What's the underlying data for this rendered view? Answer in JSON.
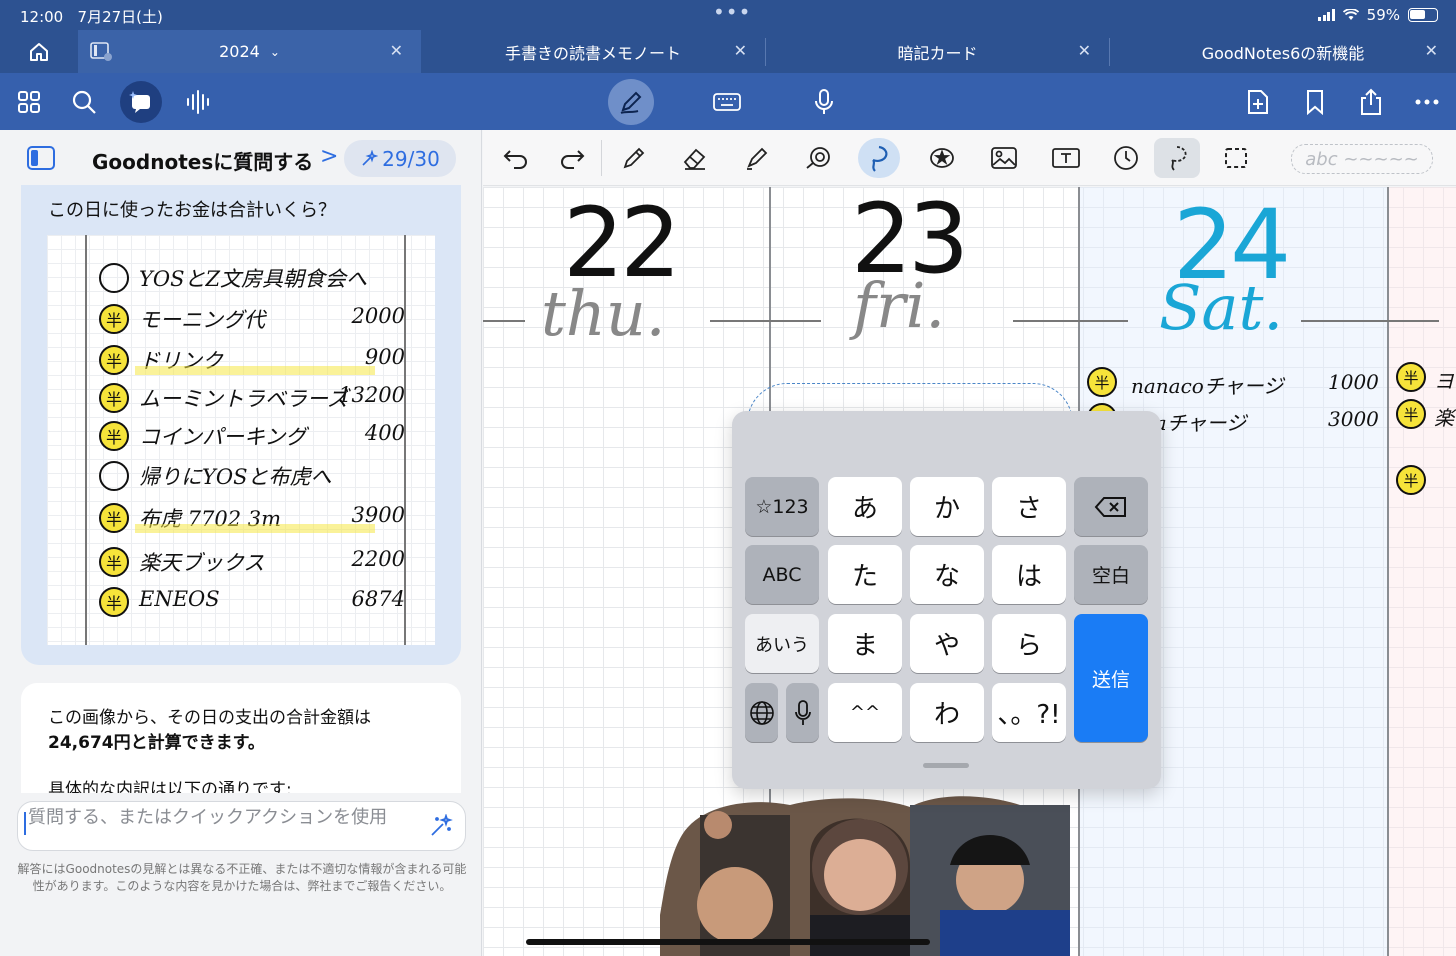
{
  "status": {
    "time": "12:00",
    "date": "7月27日(土)",
    "battery": "59%"
  },
  "tabs": [
    {
      "label": "2024",
      "active": true
    },
    {
      "label": "手書きの読書メモノート"
    },
    {
      "label": "暗記カード"
    },
    {
      "label": "GoodNotes6の新機能"
    }
  ],
  "panel": {
    "title": "Goodnotesに質問する",
    "quota": "29/30",
    "question": "この日に使ったお金は合計いくら？",
    "note_rows": [
      {
        "mark": "",
        "label": "YOSとZ文房具朝食会へ",
        "amount": ""
      },
      {
        "mark": "半",
        "label": "モーニング代",
        "amount": "2000"
      },
      {
        "mark": "半",
        "label": "ドリンク",
        "amount": "900"
      },
      {
        "mark": "半",
        "label": "ムーミントラベラーズ",
        "amount": "13200"
      },
      {
        "mark": "半",
        "label": "コインパーキング",
        "amount": "400"
      },
      {
        "mark": "",
        "label": "帰りにYOSと布虎へ",
        "amount": ""
      },
      {
        "mark": "半",
        "label": "布虎 7702 3m",
        "amount": "3900"
      },
      {
        "mark": "半",
        "label": "楽天ブックス",
        "amount": "2200"
      },
      {
        "mark": "半",
        "label": "ENEOS",
        "amount": "6874"
      }
    ],
    "answer_line1": "この画像から、その日の支出の合計金額は",
    "answer_line2": "24,674円と計算できます。",
    "answer_line3": "具体的な内訳は以下の通りです:",
    "input_placeholder": "質問する、またはクイックアクションを使用",
    "disclaimer": "解答にはGoodnotesの見解とは異なる不正確、または不適切な情報が含まれる可能性があります。このような内容を見かけた場合は、弊社までご報告ください。"
  },
  "toolrow": {
    "text_box_hint": "abc ~~~~~"
  },
  "canvas": {
    "days": [
      {
        "num": "22",
        "name": "thu."
      },
      {
        "num": "23",
        "name": "fri."
      },
      {
        "num": "24",
        "name": "Sat."
      }
    ],
    "sat_entries": [
      {
        "mark": "半",
        "label": "nanacoチャージ",
        "amount": "1000"
      },
      {
        "mark": "",
        "label": "jicaチャージ",
        "amount": "3000"
      }
    ],
    "sun_entries": [
      {
        "mark": "半",
        "label": "ヨ"
      },
      {
        "mark": "半",
        "label": "楽"
      },
      {
        "mark": "半",
        "label": ""
      }
    ]
  },
  "keyboard": {
    "keys": {
      "num": "☆123",
      "a": "あ",
      "ka": "か",
      "sa": "さ",
      "abc": "ABC",
      "ta": "た",
      "na": "な",
      "ha": "は",
      "space": "空白",
      "aiu": "あいう",
      "ma": "ま",
      "ya": "や",
      "ra": "ら",
      "send": "送信",
      "face": "^^",
      "wa": "わ",
      "punct": "、。?!"
    }
  }
}
